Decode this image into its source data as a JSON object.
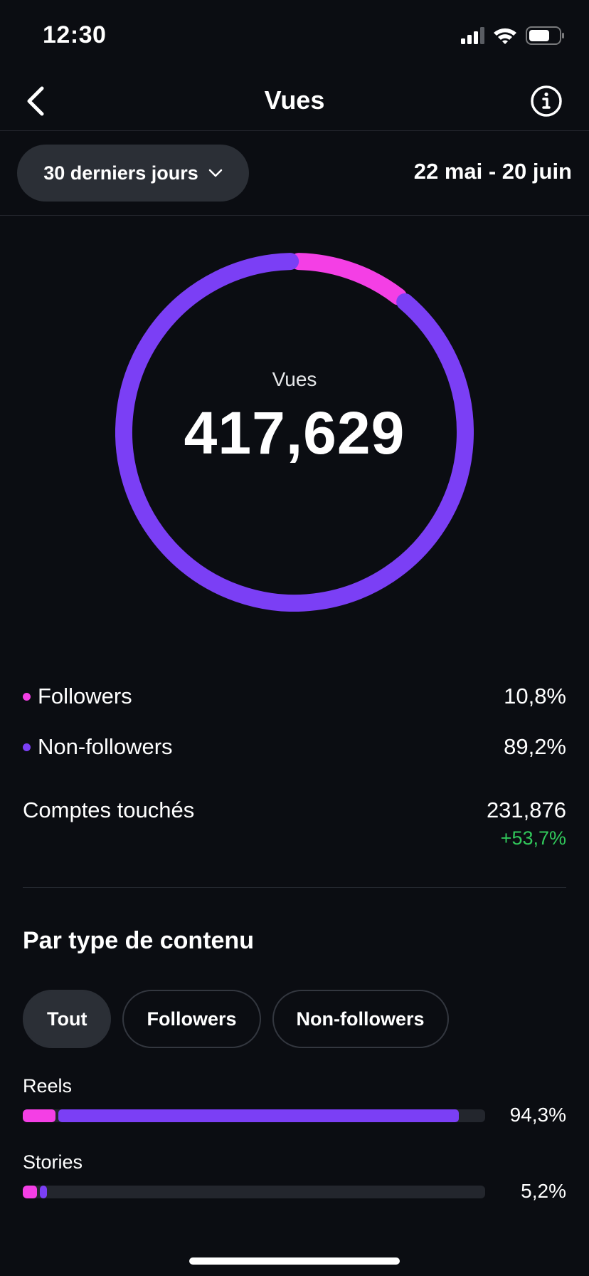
{
  "status_bar": {
    "time": "12:30"
  },
  "nav": {
    "title": "Vues"
  },
  "filter": {
    "period_label": "30 derniers jours",
    "date_range": "22 mai - 20 juin"
  },
  "donut": {
    "label": "Vues",
    "value": "417,629",
    "segments": [
      {
        "name": "Followers",
        "fraction": 0.108,
        "color": "#f43fe5"
      },
      {
        "name": "Non-followers",
        "fraction": 0.892,
        "color": "#7b3ff5"
      }
    ]
  },
  "stats": {
    "followers": {
      "label": "Followers",
      "value": "10,8%",
      "color": "#f43fe5"
    },
    "non_followers": {
      "label": "Non-followers",
      "value": "89,2%",
      "color": "#7b3ff5"
    },
    "reach": {
      "label": "Comptes touchés",
      "value": "231,876",
      "delta": "+53,7%"
    }
  },
  "content_type": {
    "title": "Par type de contenu",
    "chips": [
      "Tout",
      "Followers",
      "Non-followers"
    ],
    "rows": [
      {
        "label": "Reels",
        "value": "94,3%",
        "total_fraction": 0.943,
        "followers_fraction": 0.07
      },
      {
        "label": "Stories",
        "value": "5,2%",
        "total_fraction": 0.052,
        "followers_fraction": 0.03
      }
    ]
  },
  "colors": {
    "followers": "#f43fe5",
    "non_followers": "#7b3ff5",
    "positive": "#31c85b",
    "background": "#0b0d12"
  }
}
